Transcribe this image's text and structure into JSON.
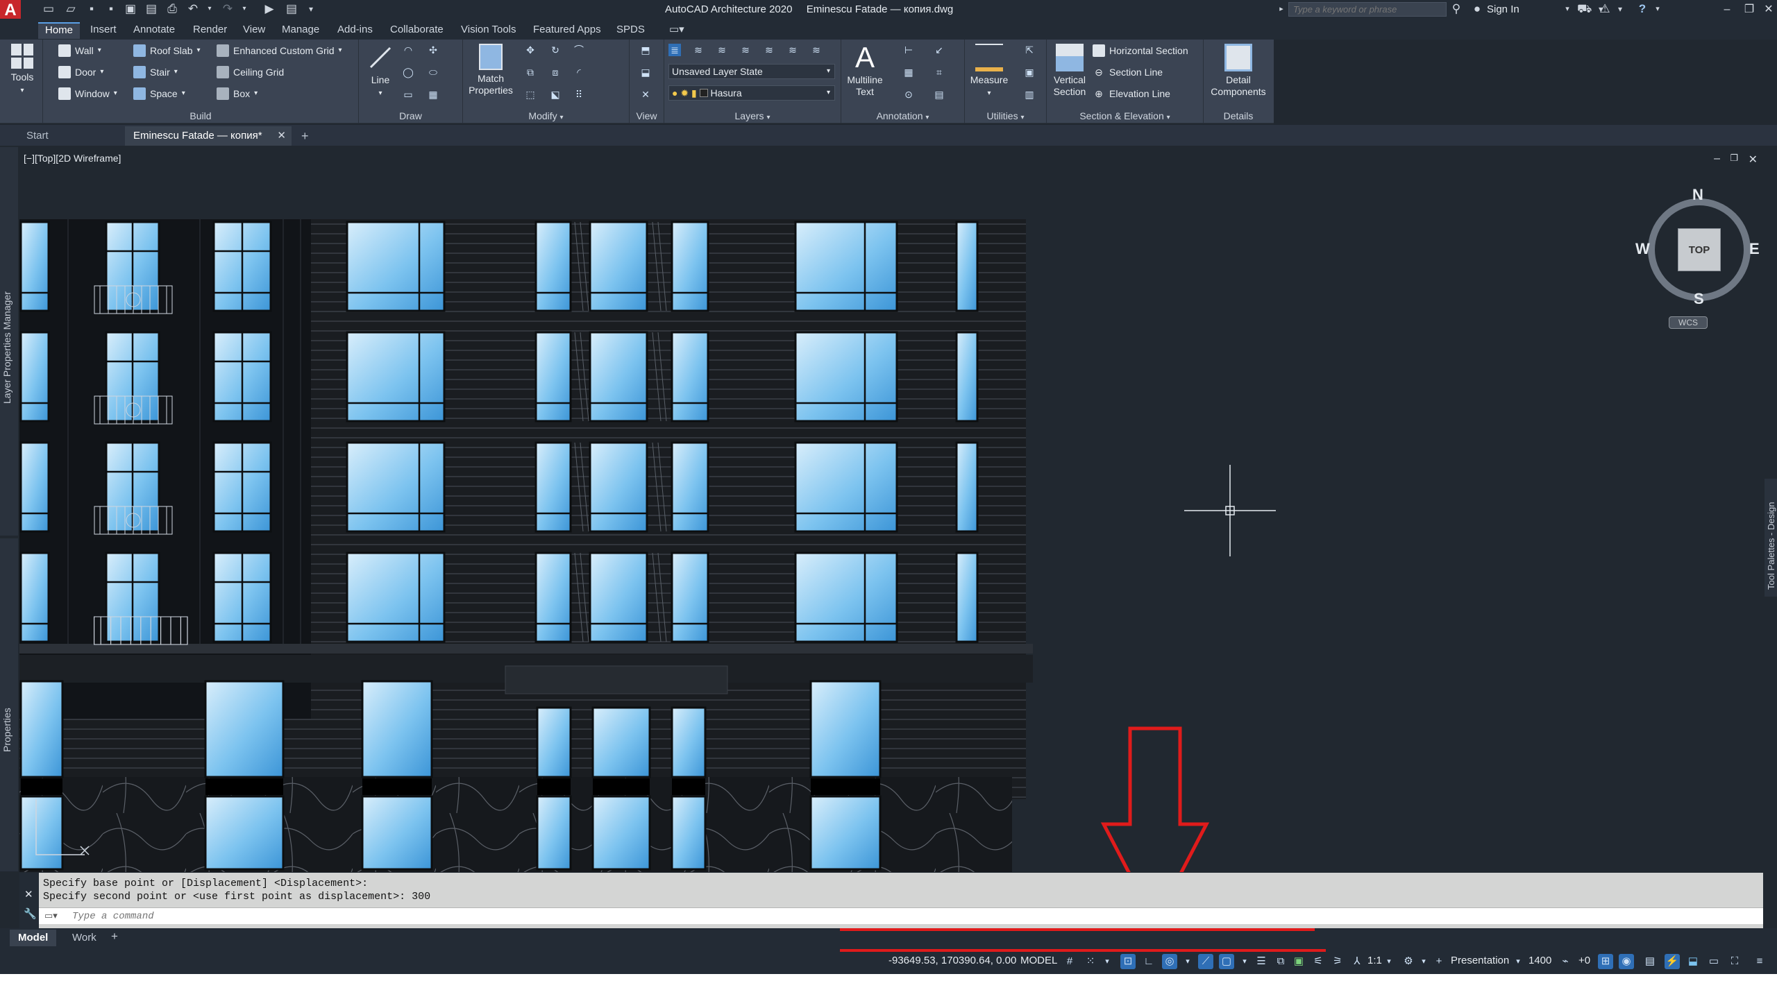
{
  "app": {
    "title": "AutoCAD Architecture 2020",
    "file_name": "Eminescu Fatade — копия.dwg",
    "logo_letter": "A"
  },
  "search": {
    "placeholder": "Type a keyword or phrase"
  },
  "account": {
    "sign_in": "Sign In"
  },
  "ribbon_tabs": [
    "Home",
    "Insert",
    "Annotate",
    "Render",
    "View",
    "Manage",
    "Add-ins",
    "Collaborate",
    "Vision Tools",
    "Featured Apps",
    "SPDS"
  ],
  "ribbon": {
    "tools": {
      "label": "Tools"
    },
    "build": {
      "title": "Build",
      "items": [
        "Wall",
        "Door",
        "Window",
        "Roof Slab",
        "Stair",
        "Space",
        "Enhanced Custom Grid",
        "Ceiling Grid",
        "Box"
      ]
    },
    "draw": {
      "title": "Draw",
      "line_label": "Line"
    },
    "modify": {
      "title": "Modify",
      "match_properties": "Match Properties"
    },
    "view": {
      "title": "View"
    },
    "layers": {
      "title": "Layers",
      "layer_state": "Unsaved Layer State",
      "current_layer": "Hasura"
    },
    "annotation": {
      "title": "Annotation",
      "multiline_text": "Multiline Text"
    },
    "utilities": {
      "title": "Utilities",
      "measure": "Measure"
    },
    "section": {
      "title": "Section & Elevation",
      "vertical_section": "Vertical Section",
      "items": [
        "Horizontal Section",
        "Section Line",
        "Elevation Line"
      ]
    },
    "details": {
      "title": "Details",
      "detail_components": "Detail Components"
    }
  },
  "doc_tabs": {
    "start": "Start",
    "active": "Eminescu Fatade — копия*",
    "add": "+"
  },
  "viewport": {
    "label": "[−][Top][2D Wireframe]"
  },
  "viewcube": {
    "north": "N",
    "south": "S",
    "east": "E",
    "west": "W",
    "face": "TOP",
    "ucs": "WCS"
  },
  "side_palettes": {
    "left_top": "Layer Properties Manager",
    "left_bottom": "Properties",
    "right": "Tool Palettes - Design"
  },
  "command": {
    "history": [
      "Specify base point or [Displacement] <Displacement>:",
      "Specify second point or <use first point as displacement>: 300"
    ],
    "placeholder": "Type a command"
  },
  "layout_tabs": [
    "Model",
    "Work"
  ],
  "status": {
    "coords": "-93649.53, 170390.64, 0.00",
    "space": "MODEL",
    "scale": "1:1",
    "workspace": "Presentation",
    "cut_plane": "1400",
    "elevation_offset": "+0"
  },
  "annotation_color": "#e01b1b"
}
